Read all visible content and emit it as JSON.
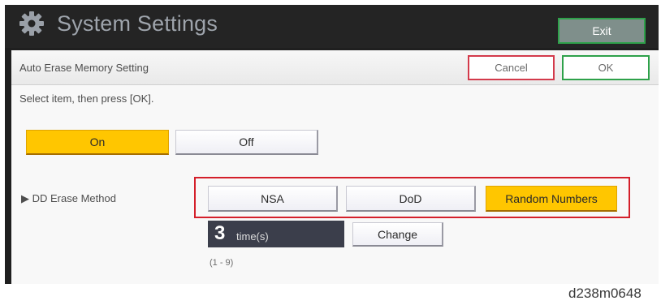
{
  "window": {
    "title": "System Settings",
    "exit_label": "Exit"
  },
  "header": {
    "setting_title": "Auto Erase Memory Setting",
    "cancel_label": "Cancel",
    "ok_label": "OK"
  },
  "instruction": "Select item, then press [OK].",
  "toggle": {
    "options": [
      {
        "label": "On",
        "selected": true
      },
      {
        "label": "Off",
        "selected": false
      }
    ]
  },
  "erase_method": {
    "label": "▶ DD Erase Method",
    "options": [
      {
        "label": "NSA",
        "selected": false
      },
      {
        "label": "DoD",
        "selected": false
      },
      {
        "label": "Random Numbers",
        "selected": true
      }
    ]
  },
  "times": {
    "value": "3",
    "unit": "time(s)",
    "change_label": "Change",
    "range": "(1 - 9)"
  },
  "caption": "d238m0648",
  "colors": {
    "selected": "#ffc600",
    "highlight_border": "#d41f2a",
    "ok_border": "#2ea14a",
    "cancel_border": "#d33a4b"
  },
  "icons": {
    "title_icon": "gear-icon"
  }
}
